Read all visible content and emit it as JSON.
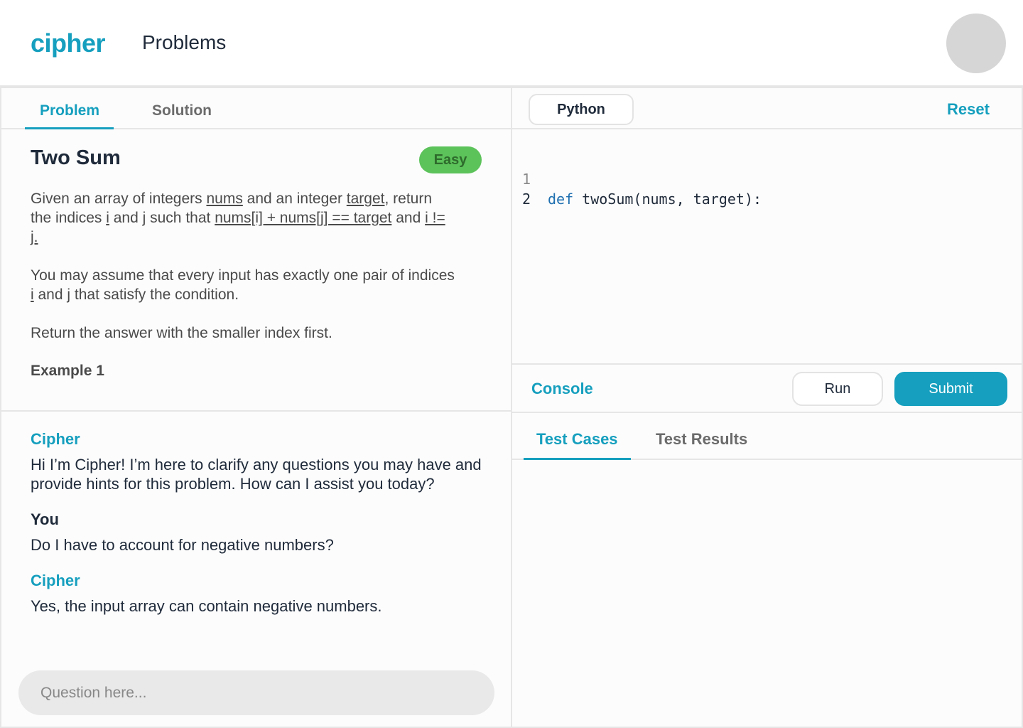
{
  "header": {
    "logo": "cipher",
    "nav_problems": "Problems"
  },
  "problem_tabs": {
    "problem": "Problem",
    "solution": "Solution"
  },
  "problem": {
    "title": "Two Sum",
    "difficulty": "Easy",
    "difficulty_color": "#5cc25a",
    "p1": {
      "t1": "Given an array of integers ",
      "nums": "nums",
      "t2": " and an integer ",
      "target": "target",
      "t3": ", return the indices ",
      "i": "i",
      "t4": " and ",
      "j": "j",
      "t5": " such that ",
      "expr": "nums[i] + nums[j] == target",
      "t6": " and ",
      "neq": "i != j."
    },
    "p2": {
      "t1": "You may assume that every input has exactly one pair of indices ",
      "i": "i",
      "t2": " and ",
      "j": "j",
      "t3": " that satisfy the condition."
    },
    "p3": "Return the answer with the smaller index first.",
    "example_head": "Example 1"
  },
  "chat": {
    "messages": [
      {
        "sender": "Cipher",
        "text": "Hi I’m Cipher! I’m here to clarify any questions you may have and provide hints for this problem. How can I assist you today?"
      },
      {
        "sender": "You",
        "text": "Do I have to account for negative numbers?"
      },
      {
        "sender": "Cipher",
        "text": "Yes, the input array can contain negative numbers."
      }
    ],
    "input_placeholder": "Question here...",
    "input_value": ""
  },
  "editor": {
    "language": "Python",
    "reset": "Reset",
    "lines": [
      {
        "num": "1",
        "keyword": "def",
        "rest": " twoSum(nums, target):"
      },
      {
        "num": "2",
        "keyword": "",
        "rest": ""
      }
    ]
  },
  "console": {
    "label": "Console",
    "run": "Run",
    "submit": "Submit",
    "tabs": {
      "test_cases": "Test Cases",
      "test_results": "Test Results"
    }
  },
  "colors": {
    "accent": "#169fbe",
    "text": "#1f2a3a",
    "muted": "#6b6b6b",
    "keyword": "#1e6fb0"
  }
}
